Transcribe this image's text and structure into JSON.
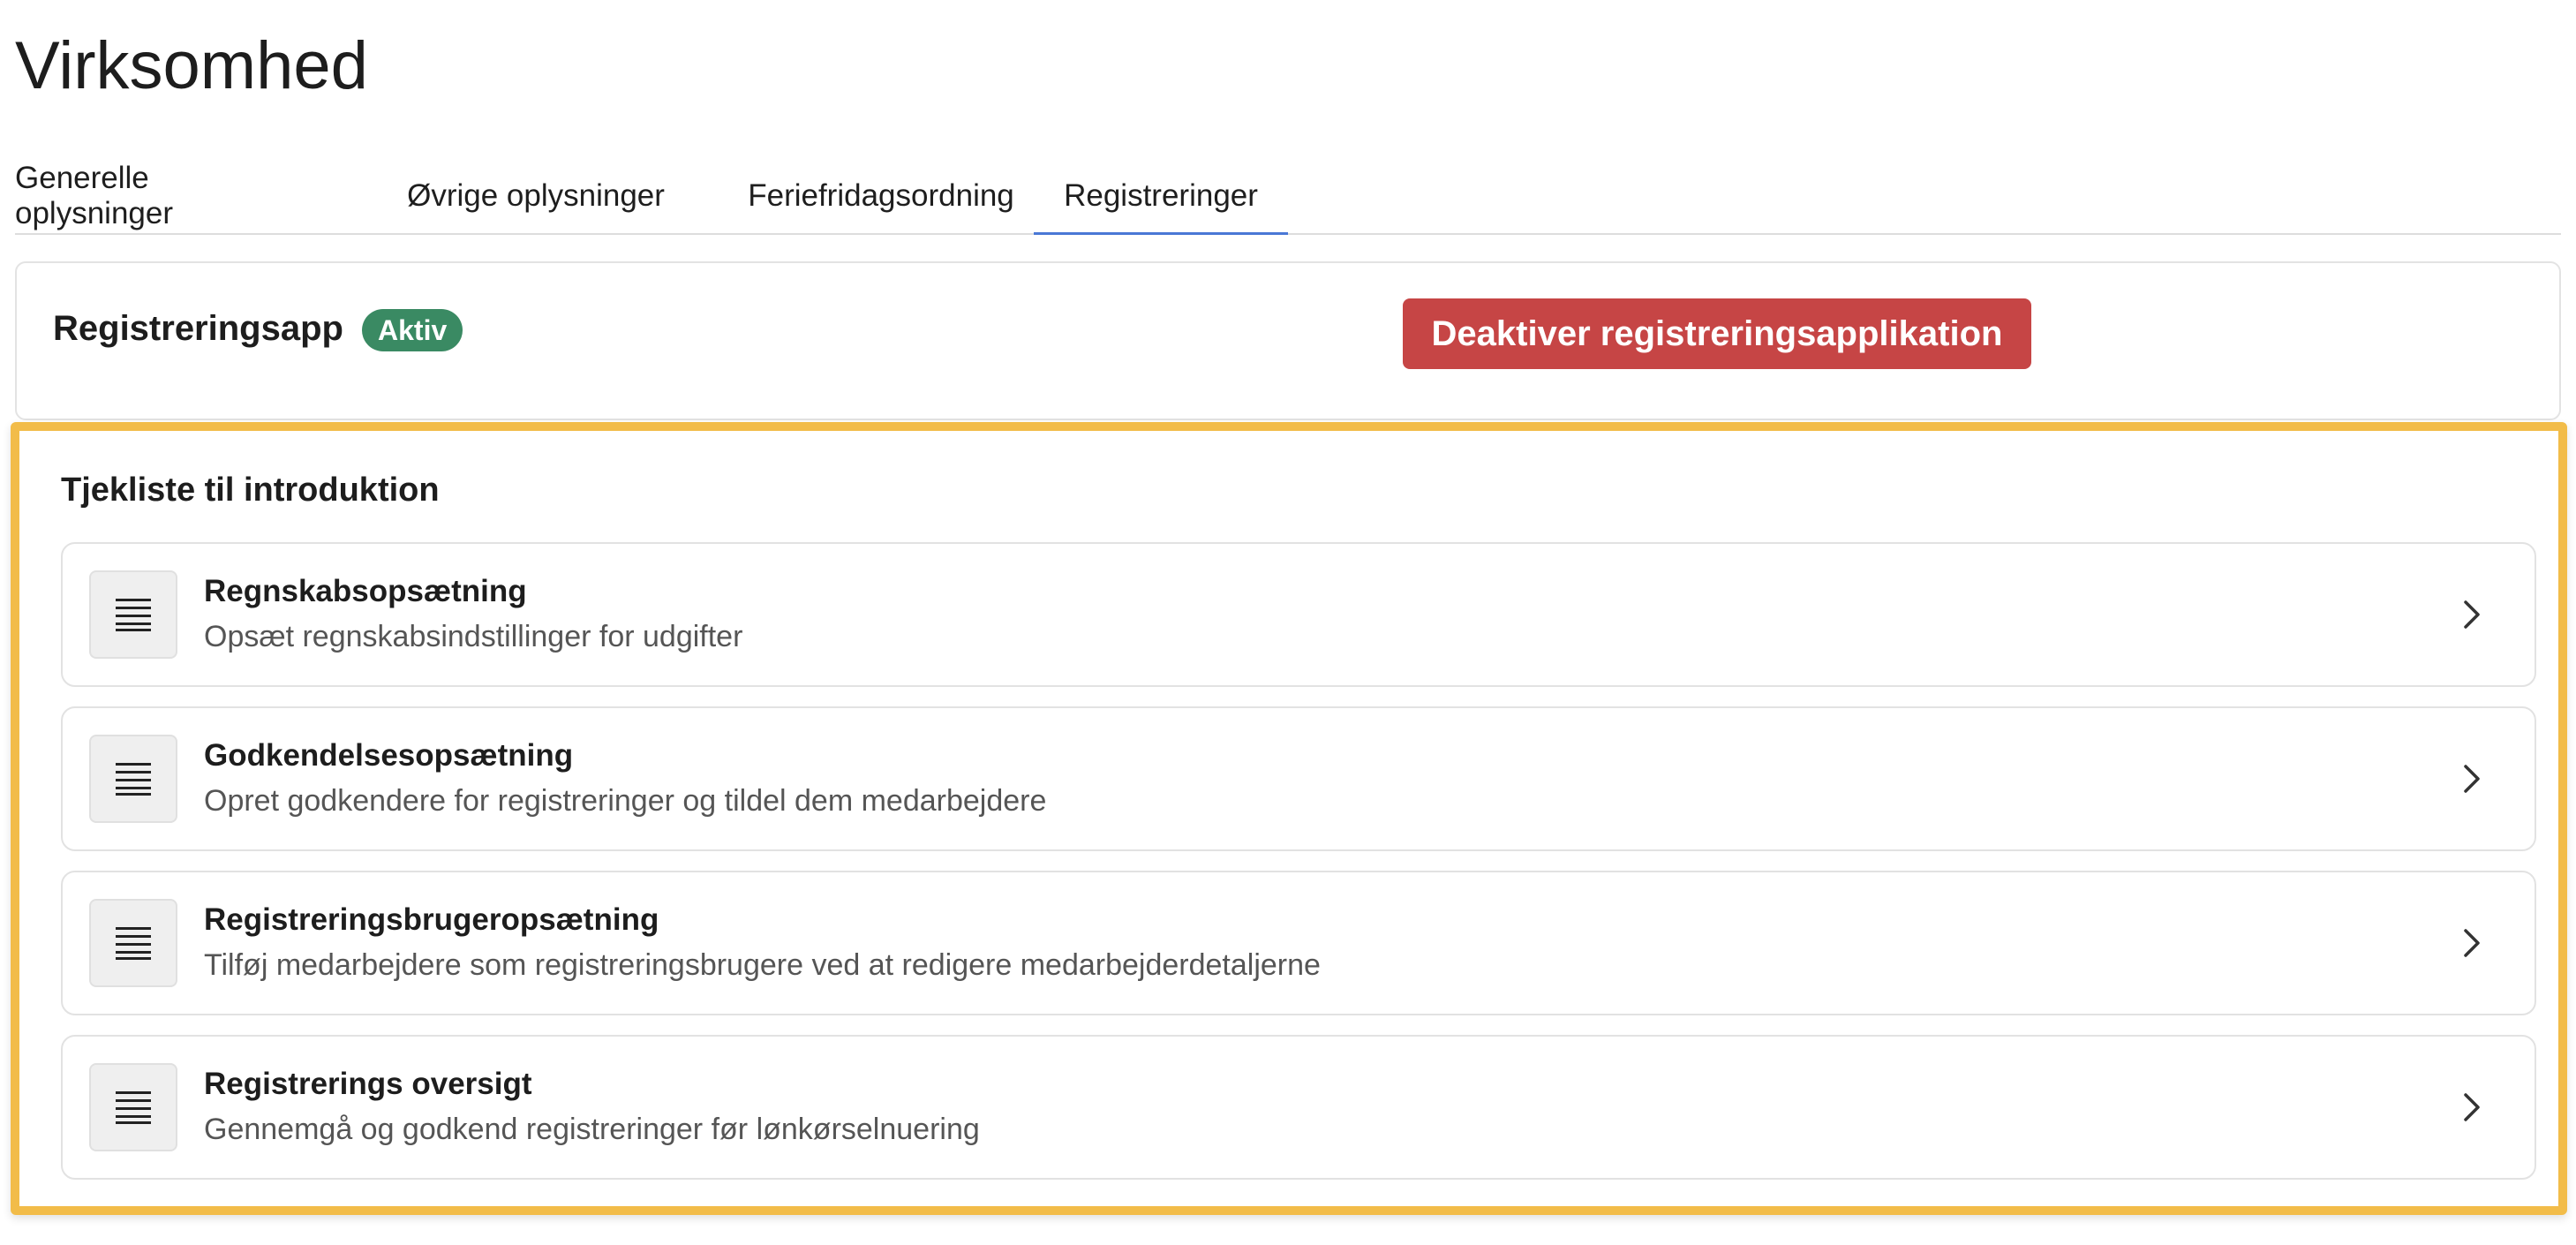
{
  "page": {
    "title": "Virksomhed"
  },
  "tabs": [
    {
      "label": "Generelle oplysninger",
      "active": false
    },
    {
      "label": "Øvrige oplysninger",
      "active": false
    },
    {
      "label": "Feriefridagsordning",
      "active": false
    },
    {
      "label": "Registreringer",
      "active": true
    }
  ],
  "app_card": {
    "title": "Registreringsapp",
    "status_badge": "Aktiv",
    "deactivate_label": "Deaktiver registreringsapplikation"
  },
  "checklist": {
    "title": "Tjekliste til introduktion",
    "items": [
      {
        "title": "Regnskabsopsætning",
        "description": "Opsæt regnskabsindstillinger for udgifter",
        "icon": "list-icon"
      },
      {
        "title": "Godkendelsesopsætning",
        "description": "Opret godkendere for registreringer og tildel dem medarbejdere",
        "icon": "list-icon"
      },
      {
        "title": "Registreringsbrugeropsætning",
        "description": "Tilføj medarbejdere som registreringsbrugere ved at redigere medarbejderdetaljerne",
        "icon": "list-icon"
      },
      {
        "title": "Registrerings oversigt",
        "description": "Gennemgå og godkend registreringer før lønkørselnuering",
        "icon": "list-icon"
      }
    ]
  },
  "colors": {
    "active_badge": "#3a8a63",
    "danger_button": "#c64545",
    "highlight_border": "#f2bc49",
    "active_tab_underline": "#4a78d6"
  }
}
